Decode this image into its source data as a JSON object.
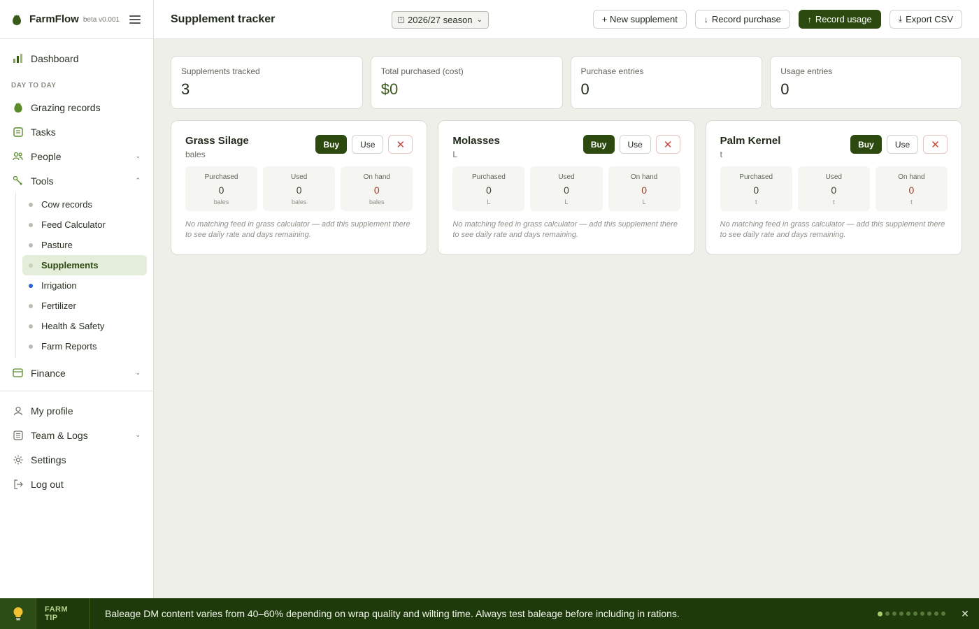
{
  "brand": {
    "name": "FarmFlow",
    "version": "beta v0.001"
  },
  "sidebar": {
    "dashboard": "Dashboard",
    "section_day_to_day": "DAY TO DAY",
    "grazing": "Grazing records",
    "tasks": "Tasks",
    "people": "People",
    "tools": "Tools",
    "tools_items": [
      "Cow records",
      "Feed Calculator",
      "Pasture",
      "Supplements",
      "Irrigation",
      "Fertilizer",
      "Health & Safety",
      "Farm Reports"
    ],
    "active_item": "Supplements",
    "finance": "Finance",
    "profile": "My profile",
    "team": "Team & Logs",
    "settings": "Settings",
    "logout": "Log out"
  },
  "header": {
    "title": "Supplement tracker",
    "season": "2026/27 season",
    "new_supplement": "+ New supplement",
    "record_purchase": "Record purchase",
    "record_usage": "Record usage",
    "export_csv": "Export CSV"
  },
  "stats": [
    {
      "label": "Supplements tracked",
      "value": "3"
    },
    {
      "label": "Total purchased (cost)",
      "value": "$0"
    },
    {
      "label": "Purchase entries",
      "value": "0"
    },
    {
      "label": "Usage entries",
      "value": "0"
    }
  ],
  "card_labels": {
    "buy": "Buy",
    "use": "Use",
    "delete": "✕",
    "purchased": "Purchased",
    "used": "Used",
    "on_hand": "On hand"
  },
  "supplements": [
    {
      "name": "Grass Silage",
      "unit": "bales",
      "purchased": "0",
      "used": "0",
      "on_hand": "0",
      "note": "No matching feed in grass calculator — add this supplement there to see daily rate and days remaining."
    },
    {
      "name": "Molasses",
      "unit": "L",
      "purchased": "0",
      "used": "0",
      "on_hand": "0",
      "note": "No matching feed in grass calculator — add this supplement there to see daily rate and days remaining."
    },
    {
      "name": "Palm Kernel",
      "unit": "t",
      "purchased": "0",
      "used": "0",
      "on_hand": "0",
      "note": "No matching feed in grass calculator — add this supplement there to see daily rate and days remaining."
    }
  ],
  "tip": {
    "label": "FARM TIP",
    "text": "Baleage DM content varies from 40–60% depending on wrap quality and wilting time. Always test baleage before including in rations.",
    "close": "✕"
  },
  "colors": {
    "brand_green": "#2c4a0f",
    "tip_bg": "#1e3a0b",
    "danger": "#a13a2e"
  }
}
